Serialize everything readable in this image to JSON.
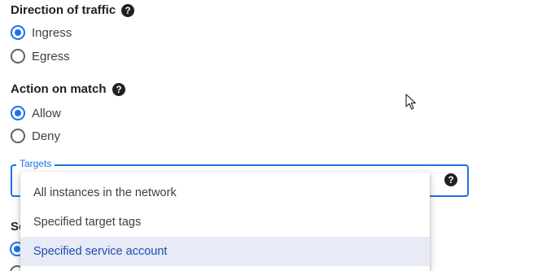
{
  "direction": {
    "heading": "Direction of traffic",
    "options": [
      {
        "label": "Ingress",
        "selected": true
      },
      {
        "label": "Egress",
        "selected": false
      }
    ]
  },
  "action": {
    "heading": "Action on match",
    "options": [
      {
        "label": "Allow",
        "selected": true
      },
      {
        "label": "Deny",
        "selected": false
      }
    ]
  },
  "targets": {
    "label": "Targets",
    "menu_items": [
      {
        "label": "All instances in the network",
        "selected": false
      },
      {
        "label": "Specified target tags",
        "selected": false
      },
      {
        "label": "Specified service account",
        "selected": true
      }
    ]
  },
  "partial_heading": "Source filter",
  "colors": {
    "accent": "#1a73e8",
    "selected_item_bg": "#e8eaf6",
    "selected_item_text": "#1a4fb0",
    "text": "#202124"
  },
  "icons": [
    "help-circle-icon",
    "mouse-pointer-icon"
  ]
}
